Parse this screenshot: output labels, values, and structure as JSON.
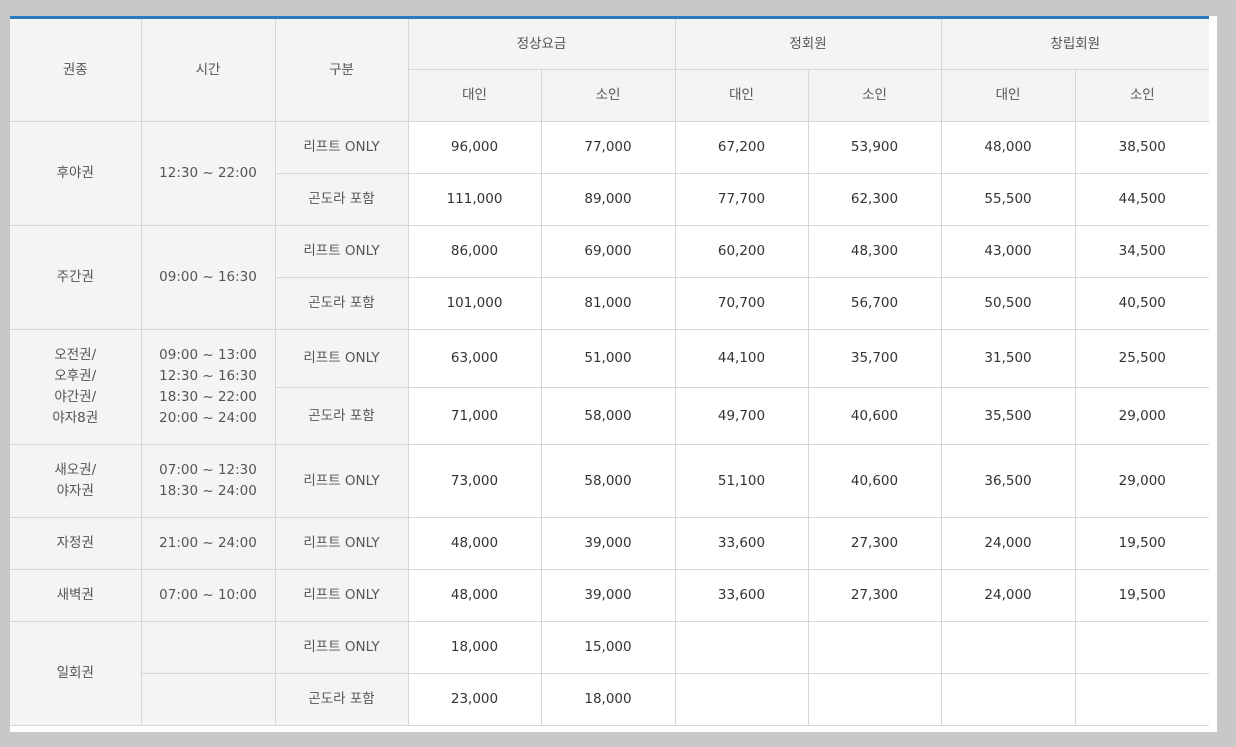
{
  "header": {
    "ticket_type": "권종",
    "time": "시간",
    "category": "구분",
    "groups": [
      "정상요금",
      "정회원",
      "창립회원"
    ],
    "sub": [
      "대인",
      "소인",
      "대인",
      "소인",
      "대인",
      "소인"
    ]
  },
  "rows": [
    {
      "type": "후야권",
      "time": "12:30 ~ 22:00",
      "items": [
        {
          "category": "리프트 ONLY",
          "values": [
            "96,000",
            "77,000",
            "67,200",
            "53,900",
            "48,000",
            "38,500"
          ]
        },
        {
          "category": "곤도라 포함",
          "values": [
            "111,000",
            "89,000",
            "77,700",
            "62,300",
            "55,500",
            "44,500"
          ]
        }
      ]
    },
    {
      "type": "주간권",
      "time": "09:00 ~ 16:30",
      "items": [
        {
          "category": "리프트 ONLY",
          "values": [
            "86,000",
            "69,000",
            "60,200",
            "48,300",
            "43,000",
            "34,500"
          ]
        },
        {
          "category": "곤도라 포함",
          "values": [
            "101,000",
            "81,000",
            "70,700",
            "56,700",
            "50,500",
            "40,500"
          ]
        }
      ]
    },
    {
      "type": "오전권/\n오후권/\n야간권/\n야자8권",
      "time": "09:00 ~ 13:00\n12:30 ~ 16:30\n18:30 ~ 22:00\n20:00 ~ 24:00",
      "items": [
        {
          "category": "리프트 ONLY",
          "values": [
            "63,000",
            "51,000",
            "44,100",
            "35,700",
            "31,500",
            "25,500"
          ]
        },
        {
          "category": "곤도라 포함",
          "values": [
            "71,000",
            "58,000",
            "49,700",
            "40,600",
            "35,500",
            "29,000"
          ]
        }
      ]
    },
    {
      "type": "새오권/\n야자권",
      "time": "07:00 ~ 12:30\n18:30 ~ 24:00",
      "items": [
        {
          "category": "리프트 ONLY",
          "values": [
            "73,000",
            "58,000",
            "51,100",
            "40,600",
            "36,500",
            "29,000"
          ]
        }
      ]
    },
    {
      "type": "자정권",
      "time": "21:00 ~ 24:00",
      "items": [
        {
          "category": "리프트 ONLY",
          "values": [
            "48,000",
            "39,000",
            "33,600",
            "27,300",
            "24,000",
            "19,500"
          ]
        }
      ]
    },
    {
      "type": "새벽권",
      "time": "07:00 ~ 10:00",
      "items": [
        {
          "category": "리프트 ONLY",
          "values": [
            "48,000",
            "39,000",
            "33,600",
            "27,300",
            "24,000",
            "19,500"
          ]
        }
      ]
    },
    {
      "type": "일회권",
      "time": "",
      "items": [
        {
          "category": "리프트 ONLY",
          "values": [
            "18,000",
            "15,000",
            "",
            "",
            "",
            ""
          ]
        },
        {
          "category": "곤도라 포함",
          "values": [
            "23,000",
            "18,000",
            "",
            "",
            "",
            ""
          ]
        }
      ]
    }
  ],
  "colors": {
    "accent_top_border": "#2b7bc0",
    "header_bg": "#f4f4f4",
    "border": "#d6d6d6",
    "background": "#c8c8c8"
  }
}
